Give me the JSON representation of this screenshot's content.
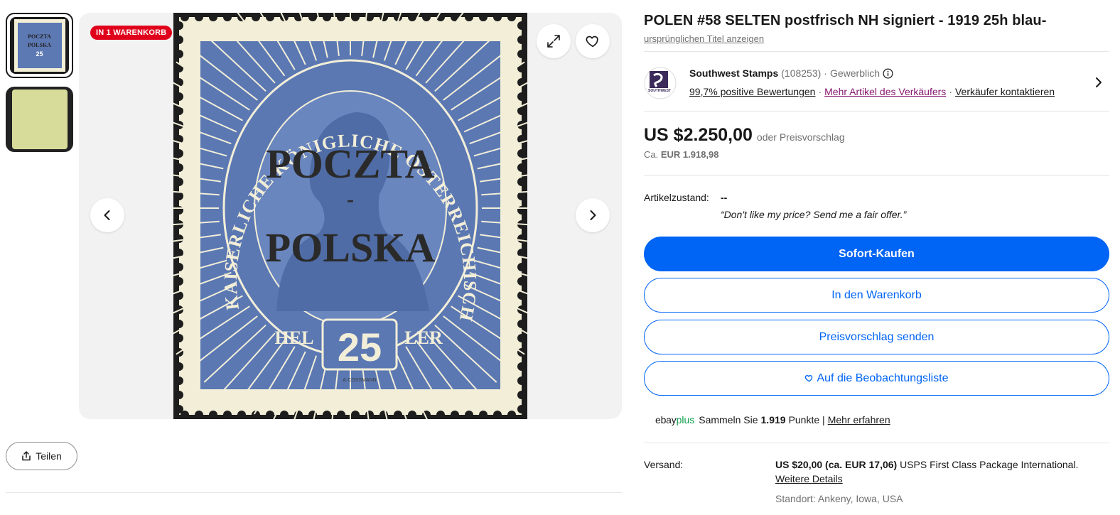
{
  "gallery": {
    "badge": "IN 1 WARENKORB",
    "stamp_text_top": "KAISERLICHE KÖNIGLICHE ÖSTERREICHISCHE POST",
    "stamp_overprint_line1": "POCZTA",
    "stamp_overprint_line2": "POLSKA",
    "stamp_value": "25",
    "stamp_heller_left": "HEL",
    "stamp_heller_right": "LER",
    "stamp_engraver": "A·COSSMANN"
  },
  "share": {
    "label": "Teilen"
  },
  "item": {
    "title": "POLEN #58 SELTEN postfrisch NH signiert - 1919 25h blau-",
    "original_title_link": "ursprünglichen Titel anzeigen"
  },
  "seller": {
    "name": "Southwest Stamps",
    "count": "(108253)",
    "type": "Gewerblich",
    "positive": "99,7% positive Bewertungen",
    "more_items": "Mehr Artikel des Verkäufers",
    "contact": "Verkäufer kontaktieren"
  },
  "price": {
    "amount": "US $2.250,00",
    "or_offer": "oder Preisvorschlag",
    "approx_prefix": "Ca.",
    "approx_value": "EUR 1.918,98"
  },
  "condition": {
    "label": "Artikelzustand:",
    "value": "--",
    "quote": "“Don't like my price? Send me a fair offer.”"
  },
  "buttons": {
    "buy_now": "Sofort-Kaufen",
    "add_to_cart": "In den Warenkorb",
    "make_offer": "Preisvorschlag senden",
    "watchlist": "Auf die Beobachtungsliste"
  },
  "ebay_plus": {
    "logo_ebay": "ebay",
    "logo_plus": "plus",
    "text_prefix": "Sammeln Sie",
    "points": "1.919",
    "text_suffix": "Punkte |",
    "link": "Mehr erfahren"
  },
  "shipping": {
    "label": "Versand:",
    "price": "US $20,00 (ca. EUR 17,06)",
    "service": "USPS First Class Package International.",
    "more_link": "Weitere Details",
    "location": "Standort: Ankeny, Iowa, USA"
  },
  "colors": {
    "accent_blue": "#0064f5",
    "badge_red": "#e0001b",
    "link_purple": "#86196f",
    "plus_green": "#0b9e47",
    "stamp_blue": "#5b78b3"
  }
}
